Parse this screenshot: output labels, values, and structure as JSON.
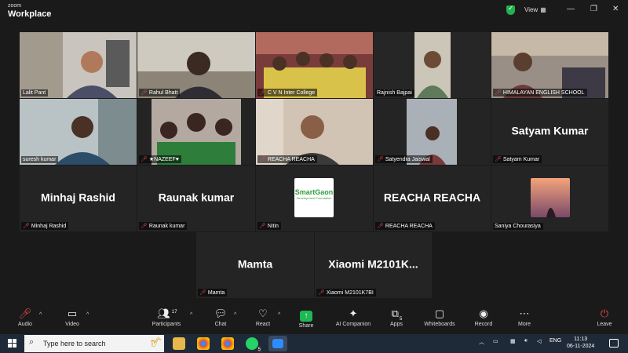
{
  "app": {
    "brand_small": "zoom",
    "brand_big": "Workplace",
    "view_label": "View",
    "view_icon": "grid-icon"
  },
  "tiles": {
    "lalit": "Lalit Pant",
    "rahul": "Rahul Bhatt",
    "cvn": "C V N Inter College",
    "rajnish": "Rajnish Bajpai",
    "himalayan": "HIMALAYAN ENGLISH SCHOOL",
    "suresh": "suresh kumar",
    "nazeef": "★NAZEEF♥",
    "reacha1": "REACHA REACHA",
    "satyendra": "Satyendra Jaiswal",
    "satyam": "Satyam Kumar",
    "satyam_big": "Satyam Kumar",
    "minhaj": "Minhaj Rashid",
    "minhaj_big": "Minhaj Rashid",
    "raunak": "Raunak kumar",
    "raunak_big": "Raunak kumar",
    "nitin": "Nitin",
    "nitin_logo_line1": "SmartGaon",
    "nitin_logo_line2": "Development Foundation",
    "reacha2": "REACHA REACHA",
    "reacha2_big": "REACHA REACHA",
    "saniya": "Saniya Chourasiya",
    "mamta": "Mamta",
    "mamta_big": "Mamta",
    "xiaomi": "Xiaomi M2101K7BI",
    "xiaomi_big": "Xiaomi  M2101K..."
  },
  "toolbar": {
    "audio": "Audio",
    "video": "Video",
    "participants": "Participants",
    "participants_count": "17",
    "chat": "Chat",
    "react": "React",
    "share": "Share",
    "ai": "AI Companion",
    "apps": "Apps",
    "whiteboards": "Whiteboards",
    "record": "Record",
    "more": "More",
    "leave": "Leave",
    "apps_badge": "5"
  },
  "taskbar": {
    "search_placeholder": "Type here to search",
    "lang": "ENG",
    "time": "11:13",
    "date": "06-11-2024",
    "whatsapp_badge": "5"
  },
  "colors": {
    "active_border": "#23d18b",
    "muted_red": "#e5484d",
    "share_green": "#1db954",
    "smartgaon_green": "#2e9d3a"
  }
}
